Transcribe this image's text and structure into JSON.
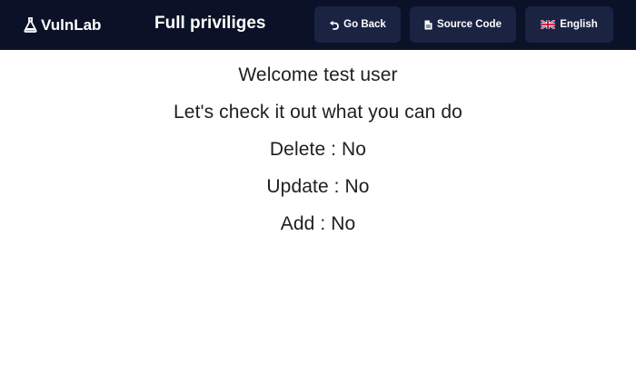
{
  "navbar": {
    "brand": "VulnLab",
    "heading": "Full priviliges",
    "buttons": {
      "back": "Go Back",
      "source": "Source Code",
      "language": "English"
    }
  },
  "main": {
    "welcome": "Welcome test user",
    "intro": "Let's check it out what you can do",
    "permissions": [
      "Delete : No",
      "Update : No",
      "Add : No"
    ]
  },
  "colors": {
    "navbar_bg": "#0b1227",
    "button_bg": "#1a2342",
    "text": "#1f1f1f"
  }
}
